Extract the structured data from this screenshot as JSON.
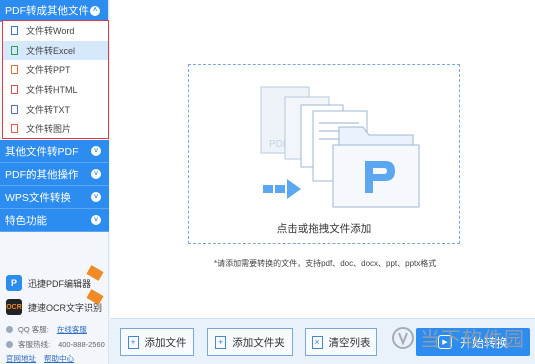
{
  "sidebar": {
    "top_category": "PDF转成其他文件",
    "sub_items": [
      {
        "label": "文件转Word",
        "icon": "word-file-icon"
      },
      {
        "label": "文件转Excel",
        "icon": "excel-file-icon"
      },
      {
        "label": "文件转PPT",
        "icon": "ppt-file-icon"
      },
      {
        "label": "文件转HTML",
        "icon": "html-file-icon"
      },
      {
        "label": "文件转TXT",
        "icon": "txt-file-icon"
      },
      {
        "label": "文件转图片",
        "icon": "image-file-icon"
      }
    ],
    "categories": [
      {
        "label": "其他文件转PDF"
      },
      {
        "label": "PDF的其他操作"
      },
      {
        "label": "WPS文件转换"
      },
      {
        "label": "特色功能"
      }
    ],
    "promos": [
      {
        "label": "迅捷PDF编辑器",
        "icon": "pdf-editor-icon"
      },
      {
        "label": "捷速OCR文字识别",
        "icon": "ocr-icon"
      }
    ],
    "contact": {
      "qq_label": "QQ 客服:",
      "qq_value": "在线客服",
      "phone_label": "客服热线:",
      "phone_value": "400-888-2560",
      "home_link": "官网地址",
      "help_link": "帮助中心"
    }
  },
  "main": {
    "drop_caption": "点击或拖拽文件添加",
    "hint": "*请添加需要转换的文件，支持pdf、doc、docx、ppt、pptx格式",
    "buttons": {
      "add_file": "添加文件",
      "add_folder": "添加文件夹",
      "clear_list": "清空列表",
      "start": "开始转换"
    }
  },
  "watermark": {
    "text": "当下软件园"
  },
  "colors": {
    "accent": "#2d8cf0",
    "highlight_border": "#e23b3b",
    "selected_row": "#d6e8fb"
  }
}
